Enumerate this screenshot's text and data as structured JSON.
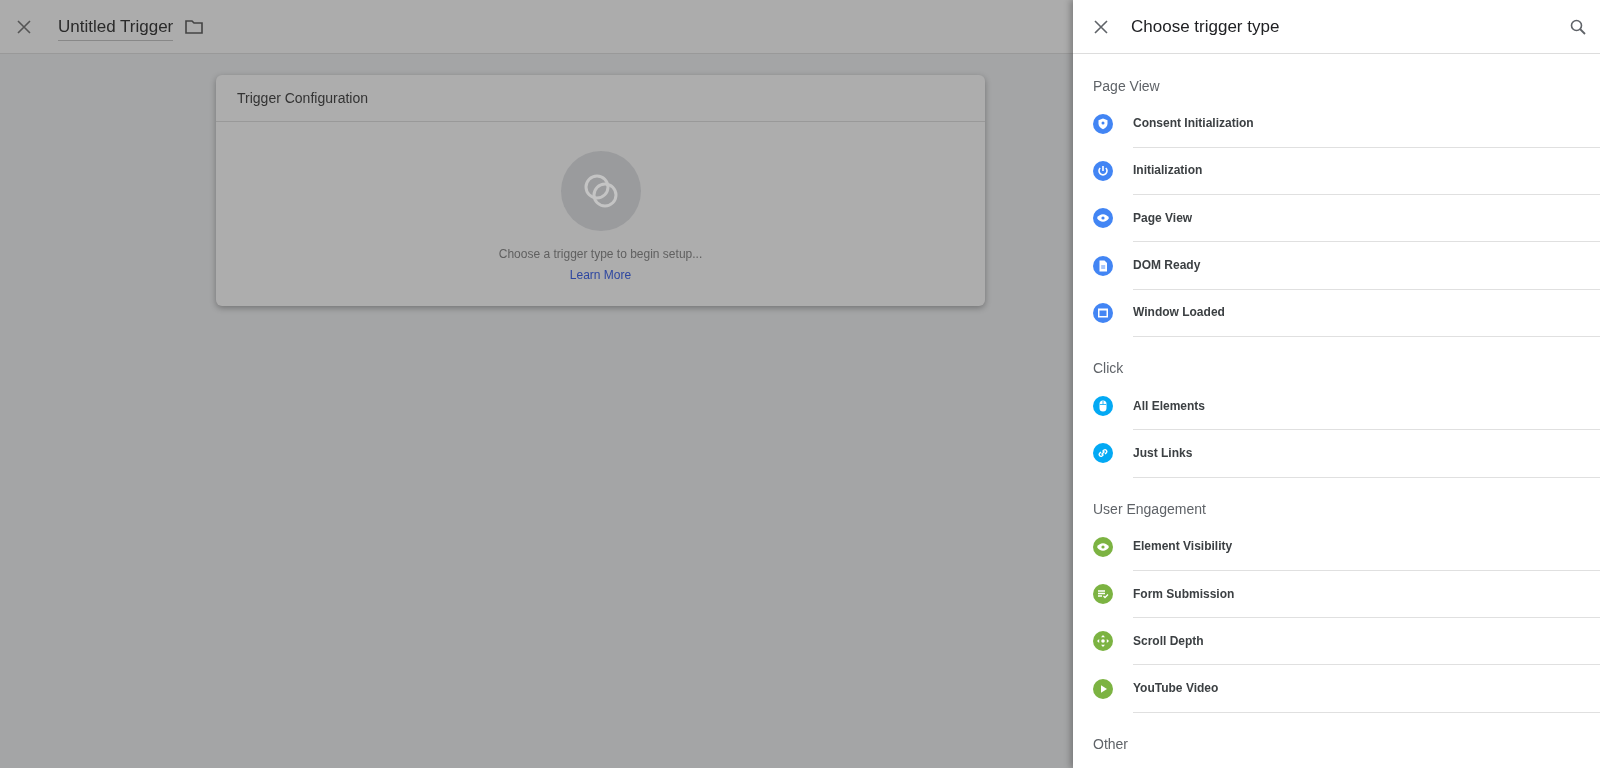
{
  "editor": {
    "title": "Untitled Trigger"
  },
  "card": {
    "title": "Trigger Configuration",
    "prompt": "Choose a trigger type to begin setup...",
    "link": "Learn More"
  },
  "panel": {
    "title": "Choose trigger type",
    "sections": [
      {
        "label": "Page View",
        "items": [
          {
            "label": "Consent Initialization",
            "kind": "shield",
            "color": "#4285f4"
          },
          {
            "label": "Initialization",
            "kind": "power",
            "color": "#4285f4"
          },
          {
            "label": "Page View",
            "kind": "eye",
            "color": "#4285f4"
          },
          {
            "label": "DOM Ready",
            "kind": "document",
            "color": "#4285f4"
          },
          {
            "label": "Window Loaded",
            "kind": "window",
            "color": "#4285f4"
          }
        ]
      },
      {
        "label": "Click",
        "items": [
          {
            "label": "All Elements",
            "kind": "mouse",
            "color": "#03a9f4"
          },
          {
            "label": "Just Links",
            "kind": "link",
            "color": "#03a9f4"
          }
        ]
      },
      {
        "label": "User Engagement",
        "items": [
          {
            "label": "Element Visibility",
            "kind": "eye",
            "color": "#7cb342"
          },
          {
            "label": "Form Submission",
            "kind": "form",
            "color": "#7cb342"
          },
          {
            "label": "Scroll Depth",
            "kind": "move",
            "color": "#7cb342"
          },
          {
            "label": "YouTube Video",
            "kind": "play",
            "color": "#7cb342"
          }
        ]
      },
      {
        "label": "Other"
      }
    ]
  }
}
